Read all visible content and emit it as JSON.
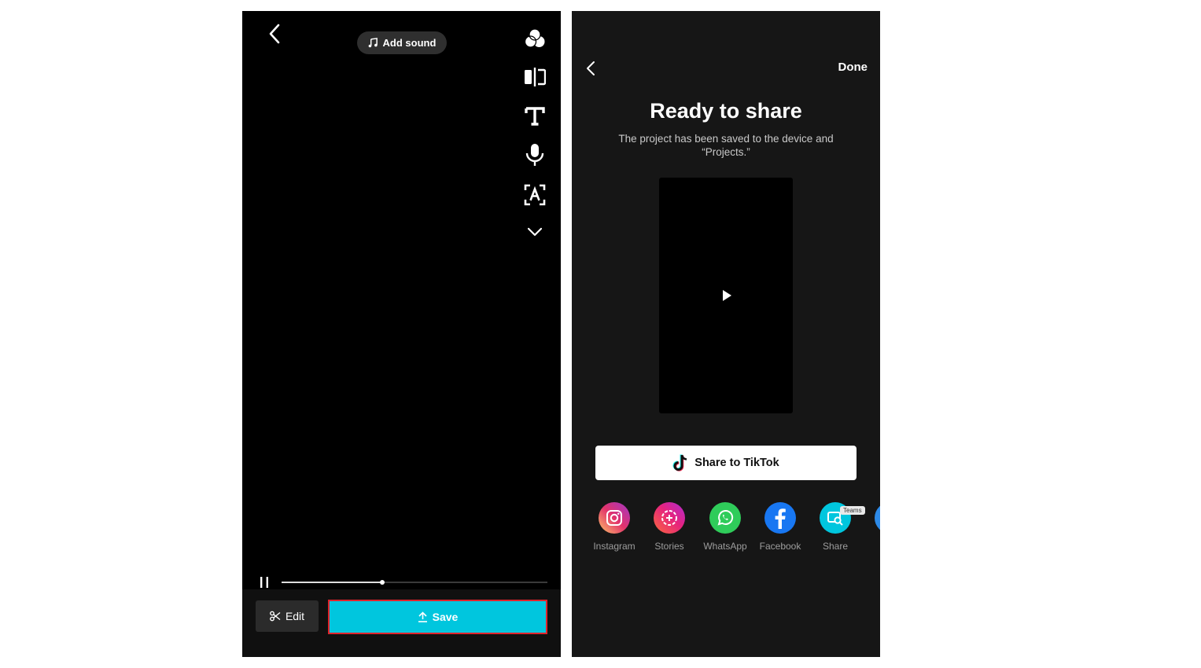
{
  "left_screen": {
    "add_sound_label": "Add sound",
    "edit_label": "Edit",
    "save_label": "Save",
    "playback_progress": 0.38,
    "tools": [
      "color-filters-icon",
      "compare-icon",
      "text-icon",
      "microphone-icon",
      "auto-captions-icon",
      "chevron-down-icon"
    ]
  },
  "right_screen": {
    "done_label": "Done",
    "title": "Ready to share",
    "subtitle": "The project has been saved to the device and “Projects.”",
    "share_tiktok_label": "Share to TikTok",
    "share_targets": [
      {
        "label": "Instagram",
        "icon": "instagram-icon"
      },
      {
        "label": "Stories",
        "icon": "stories-icon"
      },
      {
        "label": "WhatsApp",
        "icon": "whatsapp-icon"
      },
      {
        "label": "Facebook",
        "icon": "facebook-icon"
      },
      {
        "label": "Share",
        "icon": "teams-share-icon",
        "badge": "Teams"
      },
      {
        "label": "",
        "icon": "more-icon"
      }
    ]
  },
  "colors": {
    "save_bg": "#00c6de",
    "highlight_border": "#e0242c",
    "whatsapp": "#2fcc5a",
    "facebook": "#1877f2"
  }
}
